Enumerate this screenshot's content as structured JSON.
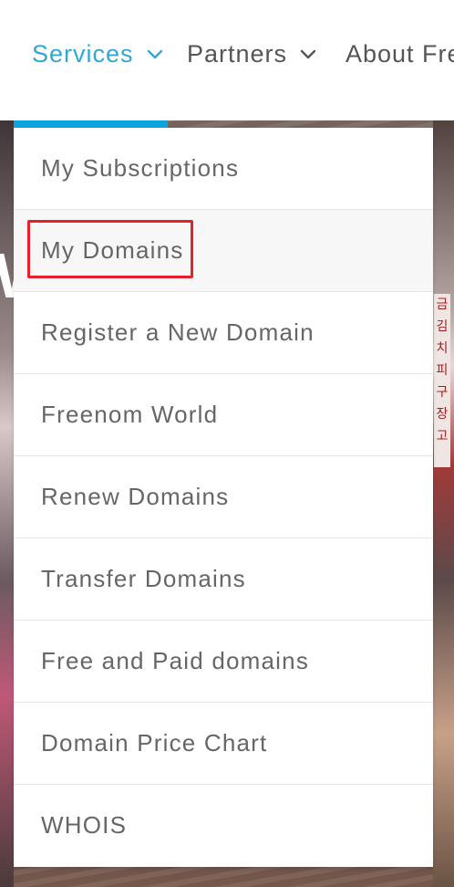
{
  "nav": {
    "items": [
      {
        "label": "Services",
        "active": true,
        "icon": "chevron-down-icon"
      },
      {
        "label": "Partners",
        "active": false,
        "icon": "chevron-down-icon"
      },
      {
        "label": "About Fre",
        "active": false
      }
    ]
  },
  "hero": {
    "partial_text": "W",
    "sign_text": [
      "금",
      "김",
      "치",
      "피",
      "구",
      "장",
      "고"
    ]
  },
  "dropdown": {
    "items": [
      {
        "label": "My Subscriptions"
      },
      {
        "label": "My Domains",
        "highlighted": true
      },
      {
        "label": "Register a New Domain"
      },
      {
        "label": "Freenom World"
      },
      {
        "label": "Renew Domains"
      },
      {
        "label": "Transfer Domains"
      },
      {
        "label": "Free and Paid domains"
      },
      {
        "label": "Domain Price Chart"
      },
      {
        "label": "WHOIS"
      }
    ]
  },
  "colors": {
    "accent": "#2fa8d8",
    "underline": "#0aa5dc",
    "highlight_border": "#e8202a",
    "menu_text": "#666666"
  }
}
